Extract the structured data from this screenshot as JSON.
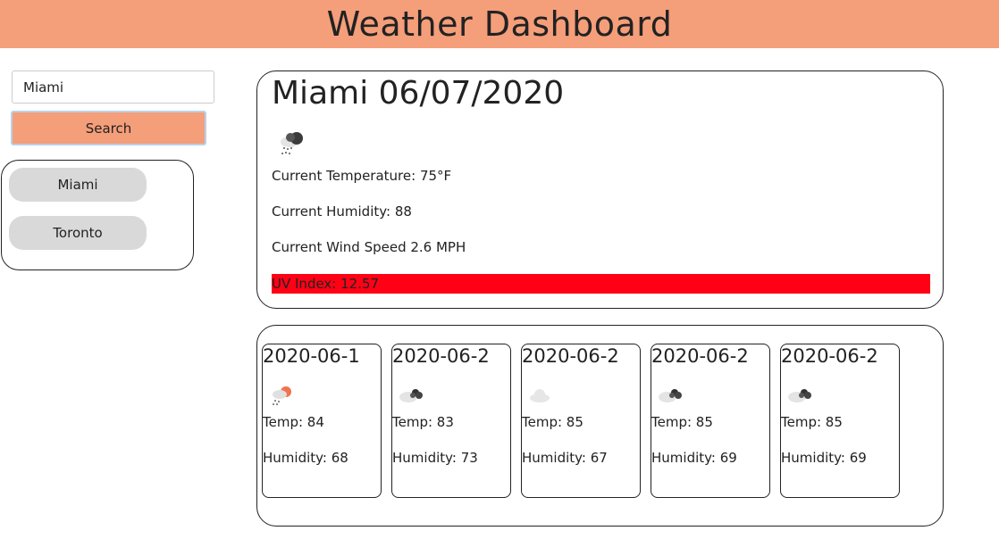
{
  "header": {
    "title": "Weather Dashboard"
  },
  "search": {
    "value": "Miami",
    "button_label": "Search"
  },
  "history": [
    {
      "label": "Miami"
    },
    {
      "label": "Toronto"
    }
  ],
  "current": {
    "title": "Miami 06/07/2020",
    "icon": "rain-cloud-icon",
    "temperature": "Current Temperature: 75°F",
    "humidity": "Current Humidity: 88",
    "wind": "Current Wind Speed 2.6 MPH",
    "uv": "UV Index: 12.57",
    "uv_color": "#ff0015"
  },
  "forecast": [
    {
      "date": "2020-06-1",
      "icon": "sun-rain-icon",
      "temp": "Temp: 84",
      "humidity": "Humidity: 68"
    },
    {
      "date": "2020-06-2",
      "icon": "broken-clouds-icon",
      "temp": "Temp: 83",
      "humidity": "Humidity: 73"
    },
    {
      "date": "2020-06-2",
      "icon": "cloud-icon",
      "temp": "Temp: 85",
      "humidity": "Humidity: 67"
    },
    {
      "date": "2020-06-2",
      "icon": "broken-clouds-icon",
      "temp": "Temp: 85",
      "humidity": "Humidity: 69"
    },
    {
      "date": "2020-06-2",
      "icon": "broken-clouds-icon",
      "temp": "Temp: 85",
      "humidity": "Humidity: 69"
    }
  ],
  "colors": {
    "header": "#f59e7a",
    "button": "#f59e7a",
    "history_pill": "#d9d9d9"
  }
}
